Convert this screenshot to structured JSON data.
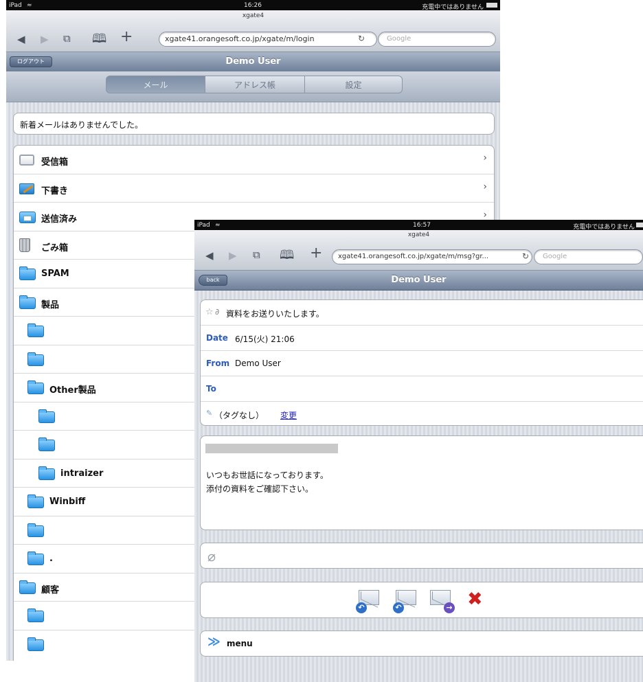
{
  "back_screen": {
    "status": {
      "device": "iPad",
      "wifi_icon": "wifi-icon",
      "time": "16:26",
      "charge": "充電中ではありません"
    },
    "browser": {
      "page_title": "xgate4",
      "url": "xgate41.orangesoft.co.jp/xgate/m/login",
      "search_placeholder": "Google"
    },
    "header": {
      "logout_label": "ログアウト",
      "title": "Demo User"
    },
    "tabs": [
      {
        "label": "メール",
        "active": true
      },
      {
        "label": "アドレス帳",
        "active": false
      },
      {
        "label": "設定",
        "active": false
      }
    ],
    "notice": "新着メールはありませんでした。",
    "folders": [
      {
        "label": "受信箱",
        "icon": "inbox-icon",
        "indent": 0,
        "chevron": true
      },
      {
        "label": "下書き",
        "icon": "drafts-icon",
        "indent": 0,
        "chevron": true
      },
      {
        "label": "送信済み",
        "icon": "sent-icon",
        "indent": 0,
        "chevron": true
      },
      {
        "label": "ごみ箱",
        "icon": "trash-icon",
        "indent": 0,
        "chevron": false
      },
      {
        "label": "SPAM",
        "icon": "folder-icon",
        "indent": 0,
        "chevron": false
      },
      {
        "label": "製品",
        "icon": "folder-icon",
        "indent": 0,
        "chevron": false
      },
      {
        "label": "",
        "icon": "folder-icon",
        "indent": 1,
        "chevron": false
      },
      {
        "label": "",
        "icon": "folder-icon",
        "indent": 1,
        "chevron": false
      },
      {
        "label": "Other製品",
        "icon": "folder-icon",
        "indent": 1,
        "chevron": false
      },
      {
        "label": "",
        "icon": "folder-icon",
        "indent": 2,
        "chevron": false
      },
      {
        "label": "",
        "icon": "folder-icon",
        "indent": 2,
        "chevron": false
      },
      {
        "label": "intraizer",
        "icon": "folder-icon",
        "indent": 2,
        "chevron": false
      },
      {
        "label": "Winbiff",
        "icon": "folder-icon",
        "indent": 1,
        "chevron": false
      },
      {
        "label": "",
        "icon": "folder-icon",
        "indent": 1,
        "chevron": false
      },
      {
        "label": ".",
        "icon": "folder-icon",
        "indent": 1,
        "chevron": false
      },
      {
        "label": "顧客",
        "icon": "folder-icon",
        "indent": 0,
        "chevron": false
      },
      {
        "label": "",
        "icon": "folder-icon",
        "indent": 1,
        "chevron": false
      },
      {
        "label": "",
        "icon": "folder-icon",
        "indent": 1,
        "chevron": false
      }
    ]
  },
  "front_screen": {
    "status": {
      "device": "iPad",
      "wifi_icon": "wifi-icon",
      "time": "16:57",
      "charge": "充電中ではありません"
    },
    "browser": {
      "page_title": "xgate4",
      "url": "xgate41.orangesoft.co.jp/xgate/m/msg?gr...",
      "search_placeholder": "Google"
    },
    "header": {
      "back_label": "back",
      "title": "Demo User"
    },
    "message": {
      "subject": "資料をお送りいたします。",
      "date_label": "Date",
      "date_value": "6/15(火) 21:06",
      "from_label": "From",
      "from_value": "Demo User",
      "to_label": "To",
      "tag_text": "（タグなし）",
      "tag_change_link": "変更",
      "body_line1": "いつもお世話になっております。",
      "body_line2": "添付の資料をご確認下さい。"
    },
    "actions": [
      {
        "name": "reply-icon",
        "badge_color": "#2f6fc7",
        "badge_glyph": "↶"
      },
      {
        "name": "reply-all-icon",
        "badge_color": "#2f6fc7",
        "badge_glyph": "↶"
      },
      {
        "name": "forward-icon",
        "badge_color": "#6a4fbf",
        "badge_glyph": "→"
      },
      {
        "name": "delete-icon",
        "badge_color": "#d01f1f",
        "badge_glyph": "✖"
      }
    ],
    "menu_label": "menu"
  }
}
